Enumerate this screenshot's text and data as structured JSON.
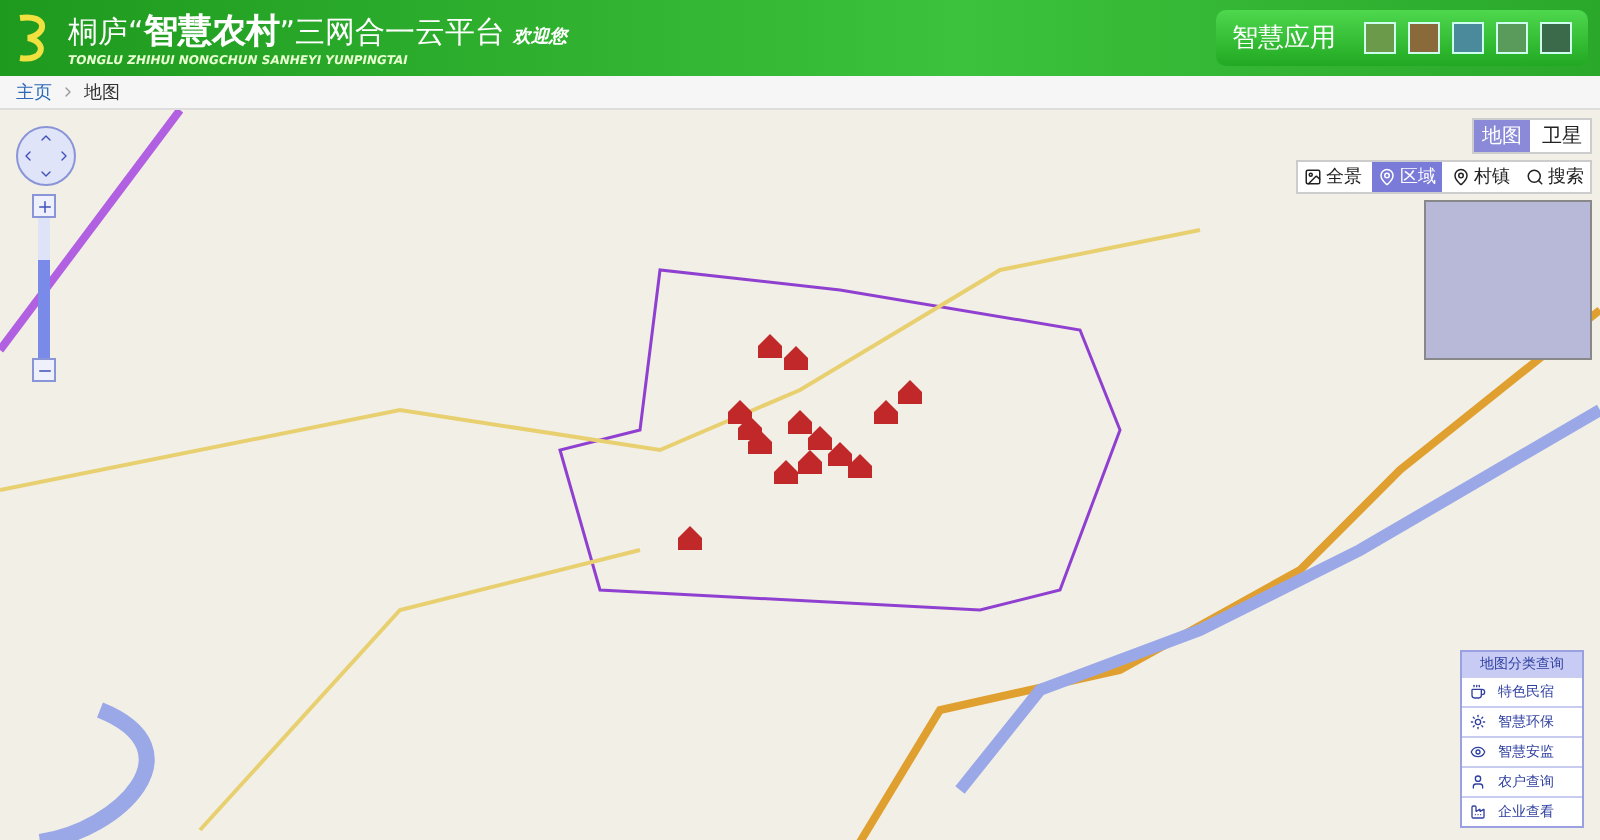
{
  "header": {
    "title_prefix": "桐庐“",
    "title_bold": "智慧农村",
    "title_suffix": "”三网合一云平台",
    "welcome": "欢迎您",
    "subtitle": "TONGLU ZHIHUI NONGCHUN SANHEYI YUNPINGTAI",
    "apps_label": "智慧应用",
    "app_tiles": [
      {
        "color": "#6a9a4a"
      },
      {
        "color": "#8a6a3a"
      },
      {
        "color": "#4a8a9a"
      },
      {
        "color": "#5a9a5a"
      },
      {
        "color": "#3a6a4a"
      }
    ]
  },
  "breadcrumb": [
    {
      "label": "主页",
      "kind": "link"
    },
    {
      "label": "地图",
      "kind": "current"
    }
  ],
  "map": {
    "zoom": {
      "level": 0.7
    },
    "type_tabs": [
      {
        "label": "地图",
        "selected": true
      },
      {
        "label": "卫星",
        "selected": false
      }
    ],
    "tools": [
      {
        "label": "全景",
        "selected": false
      },
      {
        "label": "区域",
        "selected": true
      },
      {
        "label": "村镇",
        "selected": false
      },
      {
        "label": "搜索",
        "selected": false
      }
    ],
    "legend": {
      "title": "地图分类查询",
      "items": [
        {
          "label": "特色民宿"
        },
        {
          "label": "智慧环保"
        },
        {
          "label": "智慧安监"
        },
        {
          "label": "农户查询"
        },
        {
          "label": "企业查看"
        }
      ]
    }
  }
}
